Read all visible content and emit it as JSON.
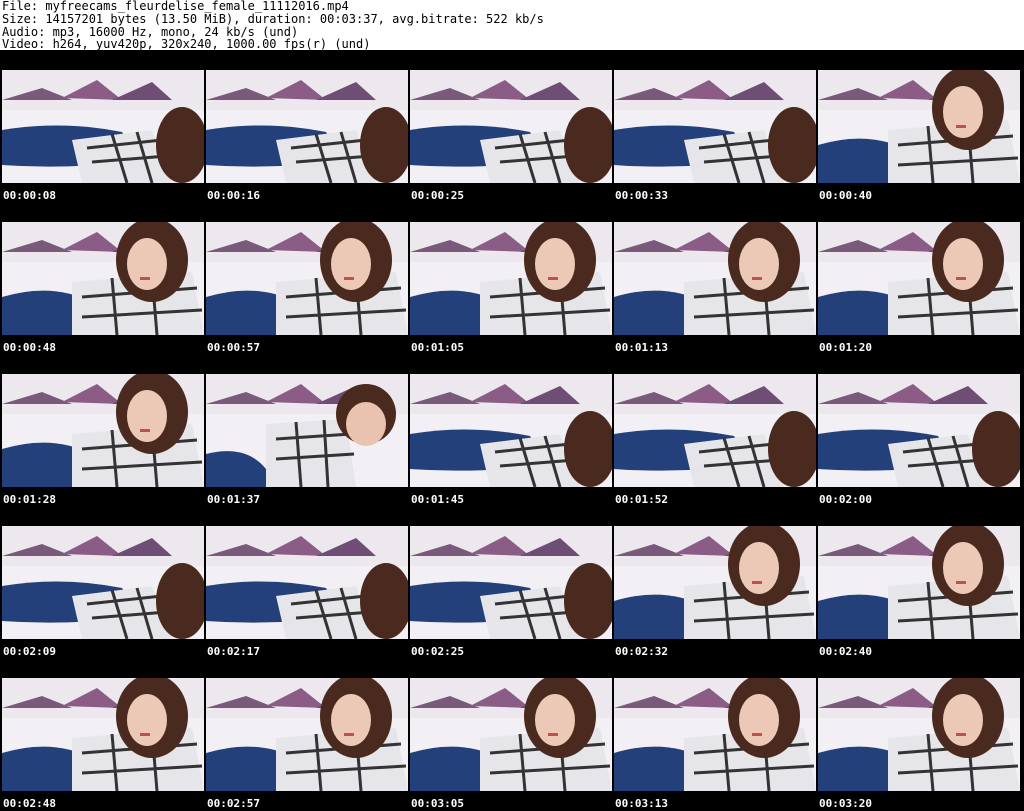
{
  "header": {
    "file_line": "File: myfreecams_fleurdelise_female_11112016.mp4",
    "size_line": "Size: 14157201 bytes (13.50 MiB), duration: 00:03:37, avg.bitrate: 522 kb/s",
    "audio_line": "Audio: mp3, 16000 Hz, mono, 24 kb/s (und)",
    "video_line": "Video: h264, yuv420p, 320x240, 1000.00 fps(r) (und)"
  },
  "colors": {
    "background": "#000000",
    "header_background": "#ffffff",
    "timestamp_text": "#ffffff"
  },
  "thumbnails": [
    {
      "timestamp": "00:00:08",
      "pose": "lying"
    },
    {
      "timestamp": "00:00:16",
      "pose": "lying"
    },
    {
      "timestamp": "00:00:25",
      "pose": "lying"
    },
    {
      "timestamp": "00:00:33",
      "pose": "lying"
    },
    {
      "timestamp": "00:00:40",
      "pose": "portrait"
    },
    {
      "timestamp": "00:00:48",
      "pose": "portrait"
    },
    {
      "timestamp": "00:00:57",
      "pose": "portrait"
    },
    {
      "timestamp": "00:01:05",
      "pose": "portrait"
    },
    {
      "timestamp": "00:01:13",
      "pose": "portrait"
    },
    {
      "timestamp": "00:01:20",
      "pose": "portrait"
    },
    {
      "timestamp": "00:01:28",
      "pose": "portrait"
    },
    {
      "timestamp": "00:01:37",
      "pose": "leaning"
    },
    {
      "timestamp": "00:01:45",
      "pose": "lying"
    },
    {
      "timestamp": "00:01:52",
      "pose": "lying"
    },
    {
      "timestamp": "00:02:00",
      "pose": "lying"
    },
    {
      "timestamp": "00:02:09",
      "pose": "lying"
    },
    {
      "timestamp": "00:02:17",
      "pose": "lying"
    },
    {
      "timestamp": "00:02:25",
      "pose": "lying"
    },
    {
      "timestamp": "00:02:32",
      "pose": "portrait"
    },
    {
      "timestamp": "00:02:40",
      "pose": "portrait"
    },
    {
      "timestamp": "00:02:48",
      "pose": "portrait"
    },
    {
      "timestamp": "00:02:57",
      "pose": "portrait"
    },
    {
      "timestamp": "00:03:05",
      "pose": "portrait"
    },
    {
      "timestamp": "00:03:13",
      "pose": "portrait"
    },
    {
      "timestamp": "00:03:20",
      "pose": "portrait"
    }
  ]
}
